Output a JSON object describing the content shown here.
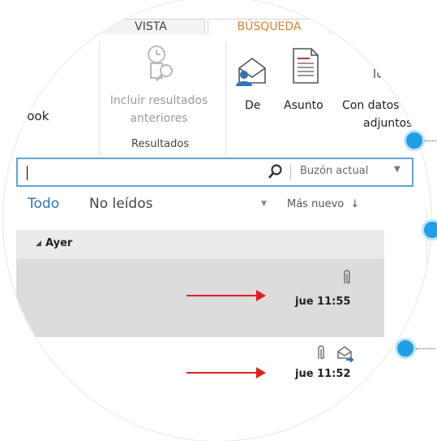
{
  "ribbon": {
    "tabs": [
      {
        "label": "VISTA"
      },
      {
        "label": "BÚSQUEDA"
      }
    ],
    "left_group": {
      "label": "Outlook"
    },
    "include_results": {
      "line1": "Incluir resultados",
      "line2": "anteriores"
    },
    "results_group_label": "Resultados",
    "from_button": "De",
    "subject_button": "Asunto",
    "attachments_button": {
      "line1": "Con datos",
      "line2": "adjuntos"
    }
  },
  "search": {
    "value": "",
    "scope": "Buzón actual"
  },
  "filters": {
    "all": "Todo",
    "unread": "No leídos",
    "sort": "Más nuevo"
  },
  "mail_list": {
    "group_header": "Ayer",
    "items": [
      {
        "time": "jue 11:55",
        "selected": true,
        "has_attachment": true
      },
      {
        "time": "jue 11:52",
        "selected": false,
        "has_attachment": true,
        "has_reply_icon": true
      }
    ]
  },
  "colors": {
    "accent_blue": "#2e75b6",
    "search_border": "#5ea4d8",
    "annotation_arrow": "#e02020",
    "hotspot_dot": "#1e9fe6"
  }
}
